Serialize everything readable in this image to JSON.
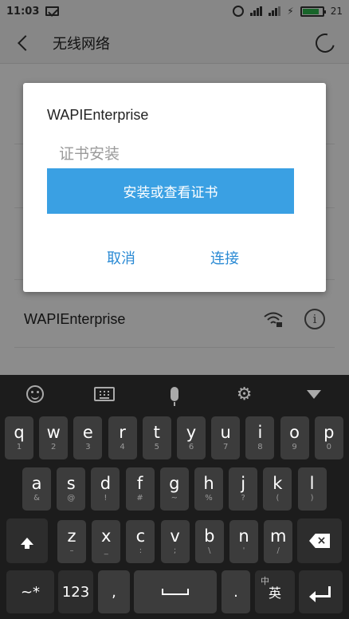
{
  "status": {
    "time": "11:03",
    "battery": "21"
  },
  "appbar": {
    "title": "无线网络"
  },
  "network": {
    "name": "WAPIEnterprise"
  },
  "dialog": {
    "title": "WAPIEnterprise",
    "subtitle": "证书安装",
    "install_button": "安装或查看证书",
    "cancel": "取消",
    "connect": "连接"
  },
  "keyboard": {
    "row1": [
      {
        "k": "q",
        "h": "1"
      },
      {
        "k": "w",
        "h": "2"
      },
      {
        "k": "e",
        "h": "3"
      },
      {
        "k": "r",
        "h": "4"
      },
      {
        "k": "t",
        "h": "5"
      },
      {
        "k": "y",
        "h": "6"
      },
      {
        "k": "u",
        "h": "7"
      },
      {
        "k": "i",
        "h": "8"
      },
      {
        "k": "o",
        "h": "9"
      },
      {
        "k": "p",
        "h": "0"
      }
    ],
    "row2": [
      {
        "k": "a",
        "h": "&"
      },
      {
        "k": "s",
        "h": "@"
      },
      {
        "k": "d",
        "h": "!"
      },
      {
        "k": "f",
        "h": "#"
      },
      {
        "k": "g",
        "h": "~"
      },
      {
        "k": "h",
        "h": "%"
      },
      {
        "k": "j",
        "h": "?"
      },
      {
        "k": "k",
        "h": "("
      },
      {
        "k": "l",
        "h": ")"
      }
    ],
    "row3": [
      {
        "k": "z",
        "h": "–"
      },
      {
        "k": "x",
        "h": "_"
      },
      {
        "k": "c",
        "h": ":"
      },
      {
        "k": "v",
        "h": ";"
      },
      {
        "k": "b",
        "h": "\\"
      },
      {
        "k": "n",
        "h": "'"
      },
      {
        "k": "m",
        "h": "/"
      }
    ],
    "symbols_label": "~*",
    "numbers_label": "123",
    "comma": ",",
    "period": ".",
    "lang_small": "中",
    "lang_main": "英"
  }
}
